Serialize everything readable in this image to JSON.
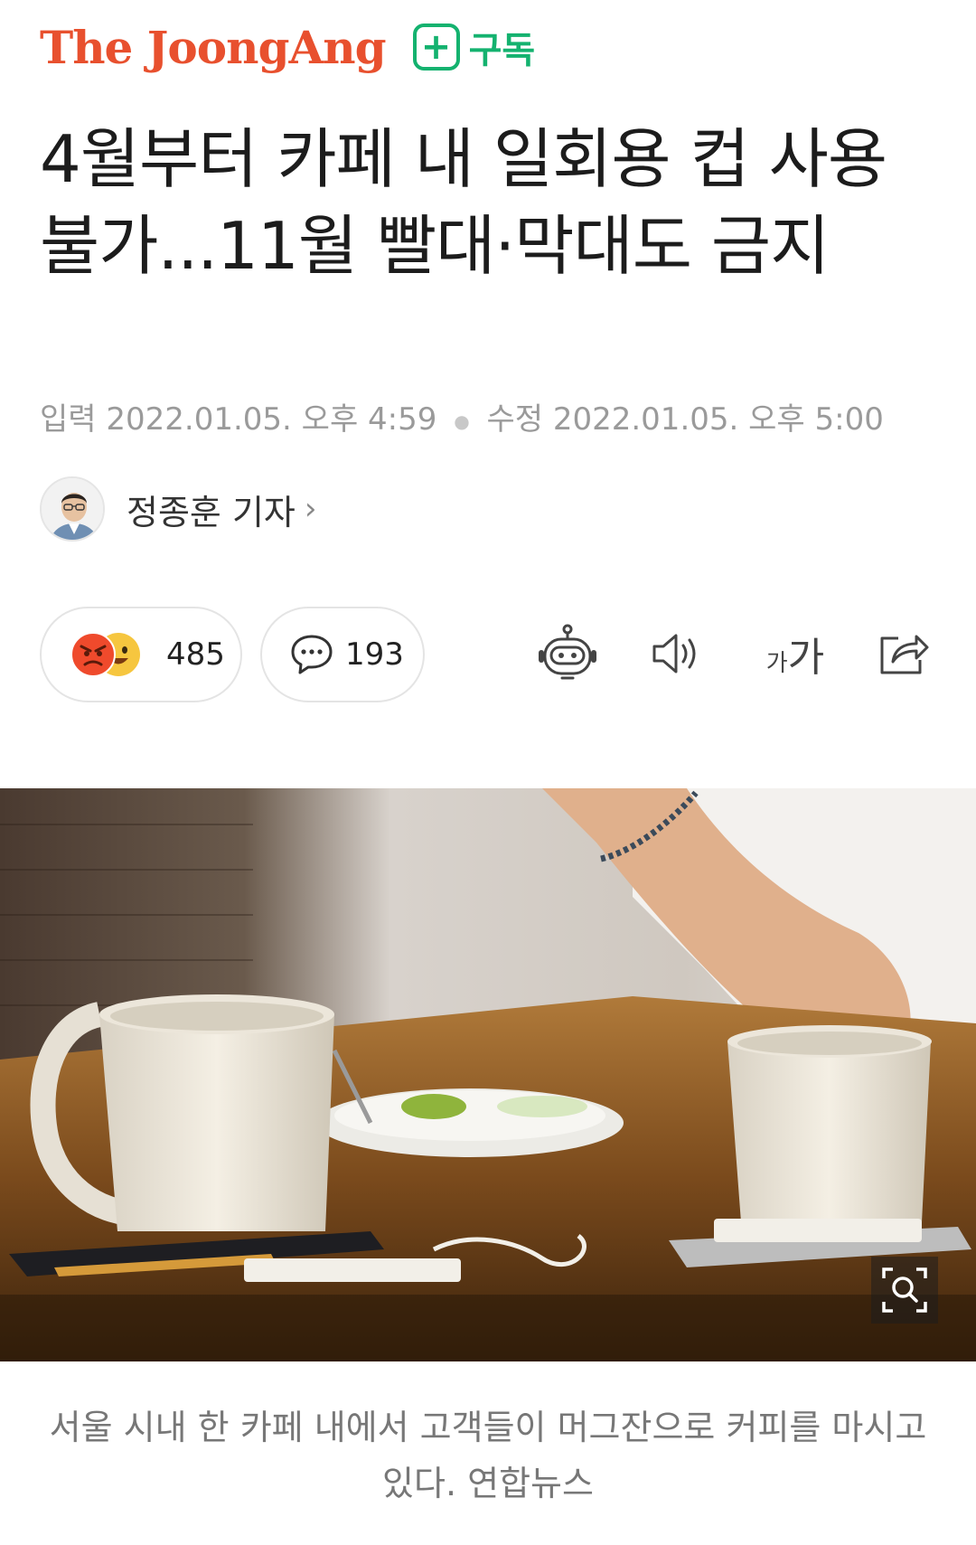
{
  "header": {
    "brand": "The JoongAng",
    "subscribe_icon": "plus-square-icon",
    "subscribe_label": "구독"
  },
  "article": {
    "headline": "4월부터 카페 내 일회용 컵 사용 불가...11월 빨대·막대도 금지",
    "dates": {
      "input_label": "입력",
      "input_value": "2022.01.05. 오후 4:59",
      "edit_label": "수정",
      "edit_value": "2022.01.05. 오후 5:00"
    },
    "reporter": {
      "name": "정종훈 기자",
      "chevron": "›"
    },
    "reactions": {
      "icons": [
        "angry-emoji-icon",
        "smile-emoji-icon"
      ],
      "count": "485"
    },
    "comments": {
      "icon": "speech-bubble-icon",
      "count": "193"
    },
    "tools": {
      "robot": "robot-summary-icon",
      "audio": "speaker-icon",
      "font_size_small": "가",
      "font_size_large": "가",
      "share": "share-icon"
    },
    "photo": {
      "zoom_icon": "zoom-search-icon"
    },
    "caption": "서울 시내 한 카페 내에서 고객들이 머그잔으로 커피를 마시고 있다. 연합뉴스"
  },
  "colors": {
    "brand": "#e8502e",
    "subscribe": "#14b26f",
    "meta_text": "#9a9a9a"
  }
}
